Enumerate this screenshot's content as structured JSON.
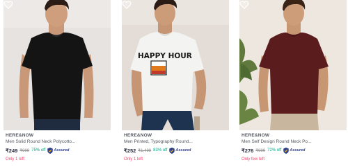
{
  "products": [
    {
      "brand": "HERE&NOW",
      "title": "Men Solid Round Neck Polycotto...",
      "price": "₹249",
      "mrp": "₹999",
      "discount": "75% off",
      "assured_label": "Assured",
      "stock": "Only 1 left",
      "tshirt_color": "#141414",
      "bg_color": "#e7e3e0"
    },
    {
      "brand": "HERE&NOW",
      "title": "Men Printed, Typography Round...",
      "price": "₹252",
      "mrp": "₹1,499",
      "discount": "83% off",
      "assured_label": "Assured",
      "stock": "Only 1 left",
      "print_text": "HAPPY HOUR",
      "tshirt_color": "#f3f3f1",
      "bg_color": "#e4ddd7"
    },
    {
      "brand": "HERE&NOW",
      "title": "Men Self Design Round Neck Po...",
      "price": "₹276",
      "mrp": "₹999",
      "discount": "72% off",
      "assured_label": "Assured",
      "stock": "Only few left",
      "tshirt_color": "#5b1c1e",
      "bg_color": "#eae4dc"
    }
  ],
  "icons": {
    "wishlist": "heart-icon",
    "assured": "shield-icon"
  },
  "colors": {
    "discount": "#03a685",
    "stock": "#ff3f6c",
    "assured": "#2d3e8e"
  }
}
